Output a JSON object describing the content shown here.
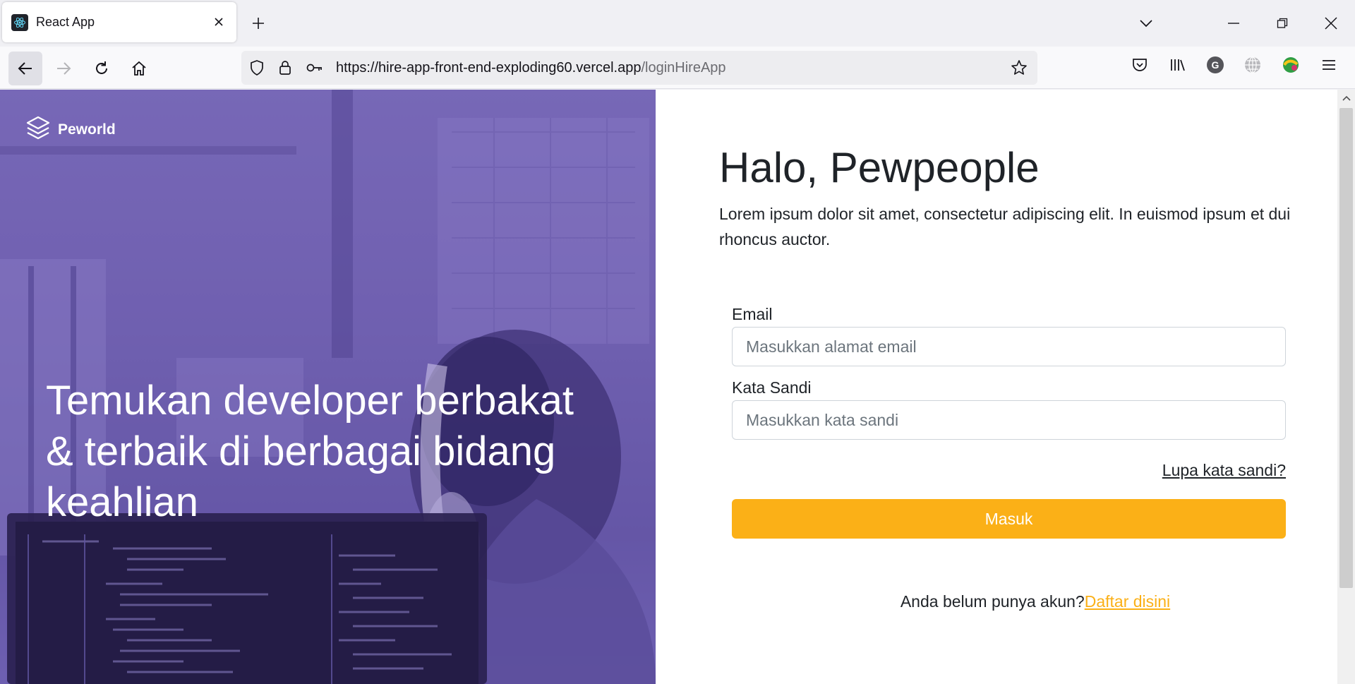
{
  "browser": {
    "tab_title": "React App",
    "url_host": "https://hire-app-front-end-exploding60.vercel.app",
    "url_path": "/loginHireApp",
    "icons": [
      "react-favicon",
      "close-icon",
      "plus-icon",
      "chevron-down-icon",
      "minimize-icon",
      "restore-icon",
      "window-close-icon",
      "back-arrow-icon",
      "forward-arrow-icon",
      "reload-icon",
      "home-icon",
      "shield-icon",
      "lock-icon",
      "key-icon",
      "star-icon",
      "pocket-icon",
      "library-icon",
      "grammarly-icon",
      "globe-icon",
      "extension-icon",
      "menu-icon"
    ]
  },
  "hero": {
    "brand": "Peworld",
    "heading": "Temukan developer berbakat & terbaik di berbagai bidang keahlian",
    "overlay_color": "#6e5eae"
  },
  "login": {
    "greeting": "Halo, Pewpeople",
    "lead": "Lorem ipsum dolor sit amet, consectetur adipiscing elit. In euismod ipsum et dui rhoncus auctor.",
    "email_label": "Email",
    "email_placeholder": "Masukkan alamat email",
    "password_label": "Kata Sandi",
    "password_placeholder": "Masukkan kata sandi",
    "forgot": "Lupa kata sandi?",
    "submit": "Masuk",
    "register_prompt": "Anda belum punya akun?",
    "register_link": "Daftar disini",
    "accent_color": "#fbb017"
  }
}
